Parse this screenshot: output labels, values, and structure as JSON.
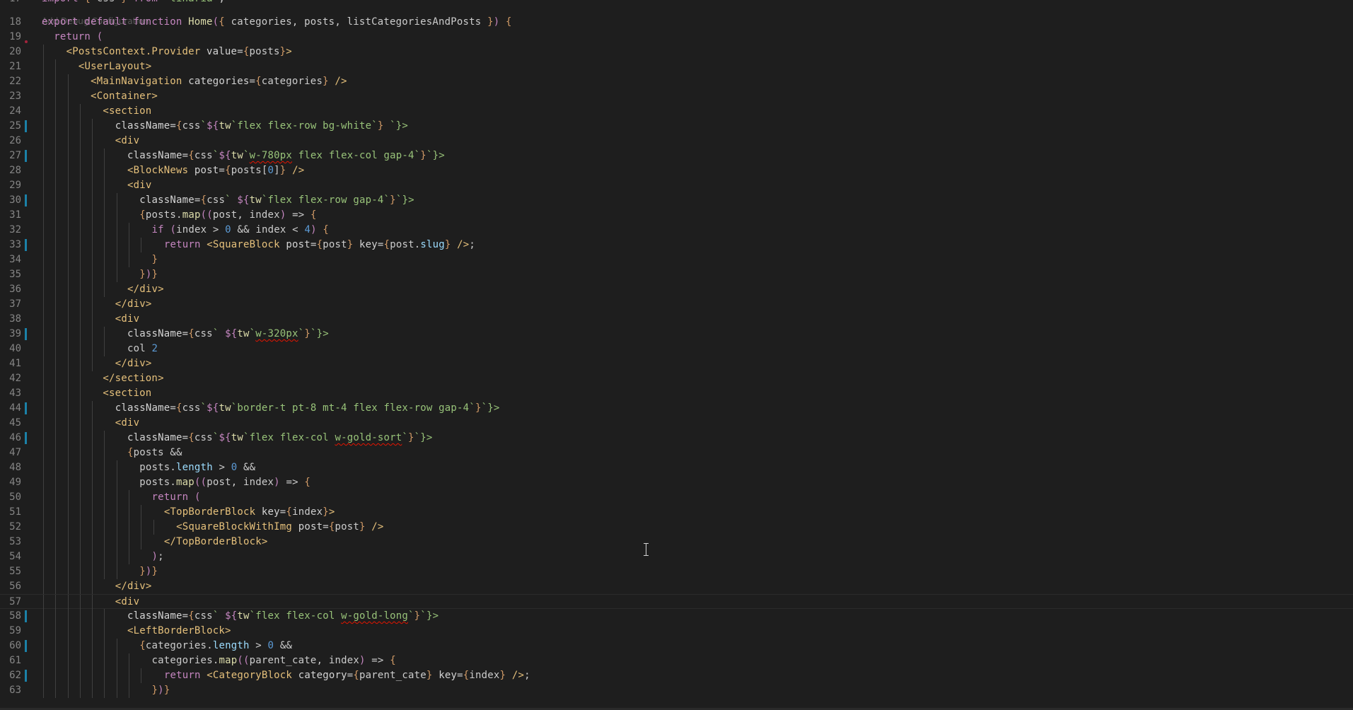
{
  "editor": {
    "codelens_text": "Add Debug Configuration",
    "colors": {
      "background": "#1e1e1e",
      "line_number": "#858585",
      "default": "#cccccc",
      "keyword": "#c586c0",
      "function": "#dcdcaa",
      "jsx_tag": "#e5c07b",
      "attribute": "#d4d4d4",
      "brace": "#d19a66",
      "string": "#98c379",
      "number": "#5c9bd6",
      "property": "#9cdcfe",
      "modified_marker": "#1b81a8"
    },
    "lines": [
      {
        "n": "17",
        "text": "import { css } from 'linaria';",
        "mod": false
      },
      {
        "n": "18",
        "text": "export default function Home({ categories, posts, listCategoriesAndPosts }) {",
        "mod": false
      },
      {
        "n": "19",
        "text": "  return (",
        "mod": false
      },
      {
        "n": "20",
        "text": "    <PostsContext.Provider value={posts}>",
        "mod": false
      },
      {
        "n": "21",
        "text": "      <UserLayout>",
        "mod": false
      },
      {
        "n": "22",
        "text": "        <MainNavigation categories={categories} />",
        "mod": false
      },
      {
        "n": "23",
        "text": "        <Container>",
        "mod": false
      },
      {
        "n": "24",
        "text": "          <section",
        "mod": false
      },
      {
        "n": "25",
        "text": "            className={css`${tw`flex flex-row bg-white`} `}>",
        "mod": true
      },
      {
        "n": "26",
        "text": "            <div",
        "mod": false
      },
      {
        "n": "27",
        "text": "              className={css`${tw`w-780px flex flex-col gap-4`}`}>",
        "mod": true
      },
      {
        "n": "28",
        "text": "              <BlockNews post={posts[0]} />",
        "mod": false
      },
      {
        "n": "29",
        "text": "              <div",
        "mod": false
      },
      {
        "n": "30",
        "text": "                className={css` ${tw`flex flex-row gap-4`}`}>",
        "mod": true
      },
      {
        "n": "31",
        "text": "                {posts.map((post, index) => {",
        "mod": false
      },
      {
        "n": "32",
        "text": "                  if (index > 0 && index < 4) {",
        "mod": false
      },
      {
        "n": "33",
        "text": "                    return <SquareBlock post={post} key={post.slug} />;",
        "mod": true
      },
      {
        "n": "34",
        "text": "                  }",
        "mod": false
      },
      {
        "n": "35",
        "text": "                })}",
        "mod": false
      },
      {
        "n": "36",
        "text": "              </div>",
        "mod": false
      },
      {
        "n": "37",
        "text": "            </div>",
        "mod": false
      },
      {
        "n": "38",
        "text": "            <div",
        "mod": false
      },
      {
        "n": "39",
        "text": "              className={css` ${tw`w-320px`}`}>",
        "mod": true
      },
      {
        "n": "40",
        "text": "              col 2",
        "mod": false
      },
      {
        "n": "41",
        "text": "            </div>",
        "mod": false
      },
      {
        "n": "42",
        "text": "          </section>",
        "mod": false
      },
      {
        "n": "43",
        "text": "          <section",
        "mod": false
      },
      {
        "n": "44",
        "text": "            className={css`${tw`border-t pt-8 mt-4 flex flex-row gap-4`}`}>",
        "mod": true
      },
      {
        "n": "45",
        "text": "            <div",
        "mod": false
      },
      {
        "n": "46",
        "text": "              className={css`${tw`flex flex-col w-gold-sort`}`}>",
        "mod": true
      },
      {
        "n": "47",
        "text": "              {posts &&",
        "mod": false
      },
      {
        "n": "48",
        "text": "                posts.length > 0 &&",
        "mod": false
      },
      {
        "n": "49",
        "text": "                posts.map((post, index) => {",
        "mod": false
      },
      {
        "n": "50",
        "text": "                  return (",
        "mod": false
      },
      {
        "n": "51",
        "text": "                    <TopBorderBlock key={index}>",
        "mod": false
      },
      {
        "n": "52",
        "text": "                      <SquareBlockWithImg post={post} />",
        "mod": false
      },
      {
        "n": "53",
        "text": "                    </TopBorderBlock>",
        "mod": false
      },
      {
        "n": "54",
        "text": "                  );",
        "mod": false
      },
      {
        "n": "55",
        "text": "                })}",
        "mod": false
      },
      {
        "n": "56",
        "text": "            </div>",
        "mod": false
      },
      {
        "n": "57",
        "text": "            <div",
        "mod": false
      },
      {
        "n": "58",
        "text": "              className={css` ${tw`flex flex-col w-gold-long`}`}>",
        "mod": true
      },
      {
        "n": "59",
        "text": "              <LeftBorderBlock>",
        "mod": false
      },
      {
        "n": "60",
        "text": "                {categories.length > 0 &&",
        "mod": true
      },
      {
        "n": "61",
        "text": "                  categories.map((parent_cate, index) => {",
        "mod": false
      },
      {
        "n": "62",
        "text": "                    return <CategoryBlock category={parent_cate} key={index} />;",
        "mod": true
      },
      {
        "n": "63",
        "text": "                  })}",
        "mod": false
      }
    ]
  }
}
